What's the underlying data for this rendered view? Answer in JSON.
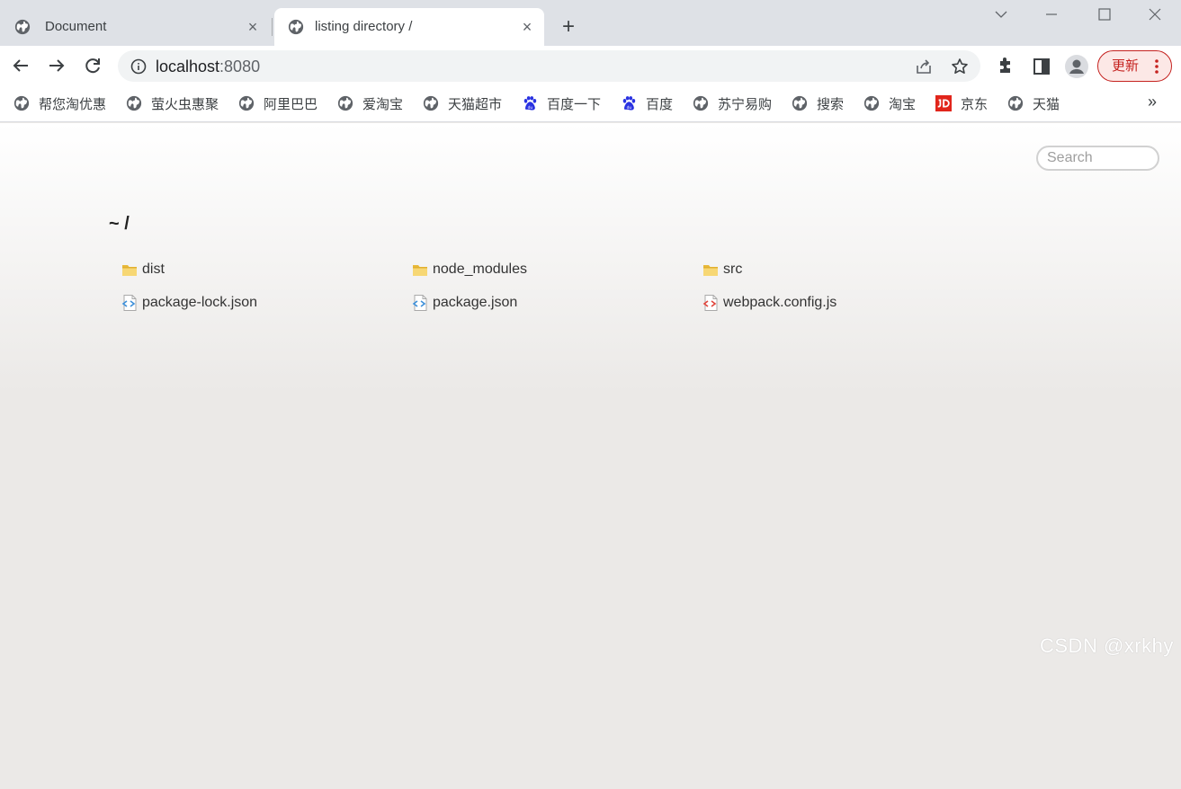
{
  "tabs": [
    {
      "title": "Document",
      "active": false
    },
    {
      "title": "listing directory /",
      "active": true
    }
  ],
  "address": {
    "host": "localhost",
    "port": ":8080"
  },
  "update_button": {
    "label": "更新"
  },
  "bookmarks": [
    {
      "label": "帮您淘优惠",
      "icon": "globe-icon"
    },
    {
      "label": "萤火虫惠聚",
      "icon": "globe-icon"
    },
    {
      "label": "阿里巴巴",
      "icon": "globe-icon"
    },
    {
      "label": "爱淘宝",
      "icon": "globe-icon"
    },
    {
      "label": "天猫超市",
      "icon": "globe-icon"
    },
    {
      "label": "百度一下",
      "icon": "baidu-paw-icon"
    },
    {
      "label": "百度",
      "icon": "baidu-paw-icon"
    },
    {
      "label": "苏宁易购",
      "icon": "globe-icon"
    },
    {
      "label": "搜索",
      "icon": "globe-icon"
    },
    {
      "label": "淘宝",
      "icon": "globe-icon"
    },
    {
      "label": "京东",
      "icon": "jd-logo-icon"
    },
    {
      "label": "天猫",
      "icon": "globe-icon"
    }
  ],
  "bookmarks_more": "»",
  "page": {
    "search_placeholder": "Search",
    "breadcrumb": "~ /",
    "files": [
      {
        "name": "dist",
        "type": "folder"
      },
      {
        "name": "node_modules",
        "type": "folder"
      },
      {
        "name": "src",
        "type": "folder"
      },
      {
        "name": "package-lock.json",
        "type": "json"
      },
      {
        "name": "package.json",
        "type": "json"
      },
      {
        "name": "webpack.config.js",
        "type": "js"
      }
    ]
  },
  "watermark": "CSDN @xrkhy",
  "colors": {
    "accent_red": "#c5221f",
    "tab_strip": "#dee1e6",
    "page_bg": "#ebe9e7"
  }
}
